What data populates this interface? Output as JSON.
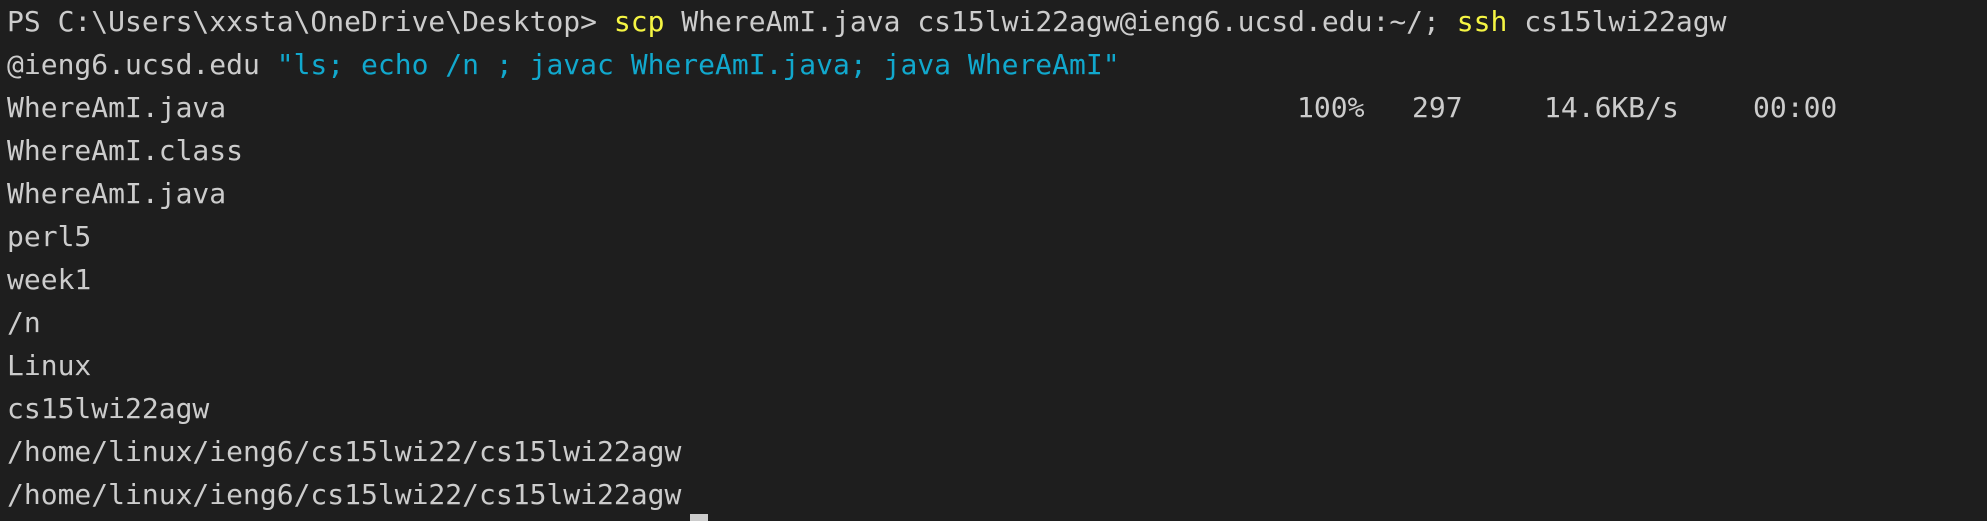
{
  "terminal": {
    "prompt": "PS C:\\Users\\xxsta\\OneDrive\\Desktop> ",
    "cmd_scp": "scp",
    "scp_args": " WhereAmI.java cs15lwi22agw@ieng6.ucsd.edu:~/; ",
    "cmd_ssh": "ssh",
    "ssh_host_part1": " cs15lwi22agw",
    "ssh_host_part2": "@ieng6.ucsd.edu ",
    "ssh_command_string": "\"ls; echo /n ; javac WhereAmI.java; java WhereAmI\"",
    "transfer": {
      "filename": "WhereAmI.java",
      "percent": "100%",
      "size": "297",
      "rate": "14.6KB/s",
      "time": "00:00"
    },
    "output_lines": [
      "WhereAmI.class",
      "WhereAmI.java",
      "perl5",
      "week1",
      "/n",
      "Linux",
      "cs15lwi22agw",
      "/home/linux/ieng6/cs15lwi22/cs15lwi22agw",
      "/home/linux/ieng6/cs15lwi22/cs15lwi22agw"
    ]
  },
  "colors": {
    "background": "#1e1e1e",
    "foreground": "#cccccc",
    "command": "#f5f543",
    "string": "#11a8cd"
  }
}
